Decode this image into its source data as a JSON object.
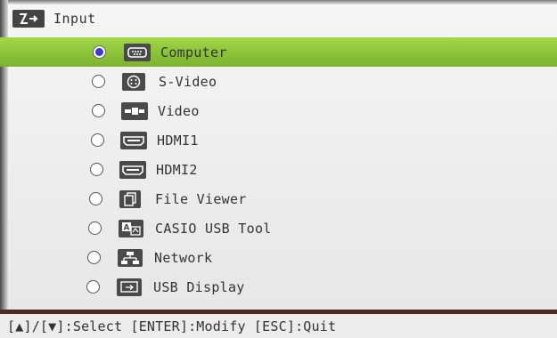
{
  "window": {
    "title": "Input",
    "title_icon": "input-switch-icon"
  },
  "inputs": [
    {
      "label": "Computer",
      "icon": "computer-port-icon",
      "selected": true
    },
    {
      "label": "S-Video",
      "icon": "svideo-port-icon",
      "selected": false
    },
    {
      "label": "Video",
      "icon": "video-port-icon",
      "selected": false
    },
    {
      "label": "HDMI1",
      "icon": "hdmi-port-icon",
      "selected": false
    },
    {
      "label": "HDMI2",
      "icon": "hdmi-port-icon",
      "selected": false
    },
    {
      "label": "File Viewer",
      "icon": "file-viewer-icon",
      "selected": false
    },
    {
      "label": "CASIO USB Tool",
      "icon": "usb-tool-icon",
      "selected": false
    },
    {
      "label": "Network",
      "icon": "network-icon",
      "selected": false
    },
    {
      "label": "USB Display",
      "icon": "usb-display-icon",
      "selected": false
    }
  ],
  "hint": "[▲]/[▼]:Select [ENTER]:Modify [ESC]:Quit",
  "colors": {
    "highlight": "#8cc43a",
    "radio_dot": "#3a3ad0",
    "hint_border": "#4e2b26"
  }
}
